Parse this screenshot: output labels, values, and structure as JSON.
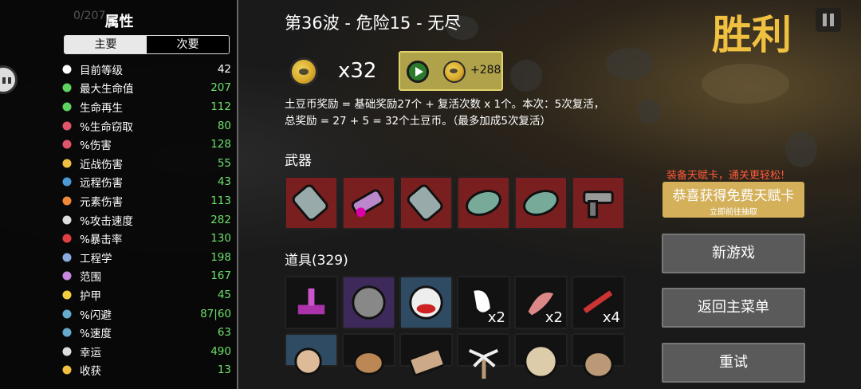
{
  "stats_panel": {
    "title": "属性",
    "tab_main": "主要",
    "tab_secondary": "次要",
    "hud_hp": "0/207",
    "items": [
      {
        "icon": "skull-icon",
        "label": "目前等级",
        "value": "42",
        "good": false
      },
      {
        "icon": "heart-icon",
        "label": "最大生命值",
        "value": "207",
        "good": true
      },
      {
        "icon": "regen-icon",
        "label": "生命再生",
        "value": "112",
        "good": true
      },
      {
        "icon": "fangs-icon",
        "label": "%生命窃取",
        "value": "80",
        "good": true
      },
      {
        "icon": "damage-icon",
        "label": "%伤害",
        "value": "128",
        "good": true
      },
      {
        "icon": "sword-icon",
        "label": "近战伤害",
        "value": "55",
        "good": true
      },
      {
        "icon": "bow-icon",
        "label": "远程伤害",
        "value": "43",
        "good": true
      },
      {
        "icon": "flame-icon",
        "label": "元素伤害",
        "value": "113",
        "good": true
      },
      {
        "icon": "hourglass-icon",
        "label": "%攻击速度",
        "value": "282",
        "good": true
      },
      {
        "icon": "crit-icon",
        "label": "%暴击率",
        "value": "130",
        "good": true
      },
      {
        "icon": "wrench-icon",
        "label": "工程学",
        "value": "198",
        "good": true
      },
      {
        "icon": "range-icon",
        "label": "范围",
        "value": "167",
        "good": true
      },
      {
        "icon": "shield-icon",
        "label": "护甲",
        "value": "45",
        "good": true
      },
      {
        "icon": "dodge-icon",
        "label": "%闪避",
        "value": "87|60",
        "good": true
      },
      {
        "icon": "boot-icon",
        "label": "%速度",
        "value": "63",
        "good": true
      },
      {
        "icon": "clover-icon",
        "label": "幸运",
        "value": "490",
        "good": true
      },
      {
        "icon": "harvest-icon",
        "label": "收获",
        "value": "13",
        "good": true
      }
    ]
  },
  "main": {
    "wave_title": "第36波 - 危险15 - 无尽",
    "coin_count": "x32",
    "bonus_amount": "+288",
    "reward_desc_line1": "土豆币奖励 = 基础奖励27个 + 复活次数 x 1个。本次：5次复活，",
    "reward_desc_line2": "总奖励 = 27 + 5 = 32个土豆币。（最多加成5次复活）",
    "weapons_label": "武器",
    "weapons": [
      {
        "name": "minigun"
      },
      {
        "name": "flamethrower"
      },
      {
        "name": "minigun"
      },
      {
        "name": "spiked-shield"
      },
      {
        "name": "spiked-shield"
      },
      {
        "name": "gatling-gun"
      }
    ],
    "items_label": "道具(329)",
    "items": [
      {
        "name": "altar",
        "count": ""
      },
      {
        "name": "mine",
        "count": ""
      },
      {
        "name": "clown-face",
        "count": ""
      },
      {
        "name": "tooth",
        "count": "x2"
      },
      {
        "name": "flesh-arm",
        "count": "x2"
      },
      {
        "name": "syringe",
        "count": "x4"
      },
      {
        "name": "snail",
        "count": ""
      },
      {
        "name": "bag",
        "count": ""
      },
      {
        "name": "banknote",
        "count": ""
      },
      {
        "name": "palm-tree",
        "count": ""
      },
      {
        "name": "ugly-face",
        "count": ""
      },
      {
        "name": "sack",
        "count": ""
      }
    ]
  },
  "right": {
    "victory": "胜利",
    "promo_note": "装备天赋卡，通关更轻松!",
    "promo_main": "恭喜获得免费天赋卡",
    "promo_sub": "立即前往抽取",
    "new_game": "新游戏",
    "main_menu": "返回主菜单",
    "retry": "重试"
  },
  "colors": {
    "accent_gold": "#f0c040",
    "stat_good": "#6de06a",
    "weapon_slot": "#7a1f1f",
    "promo_gold": "#d4b05a",
    "promo_note": "#ff5a3a"
  }
}
